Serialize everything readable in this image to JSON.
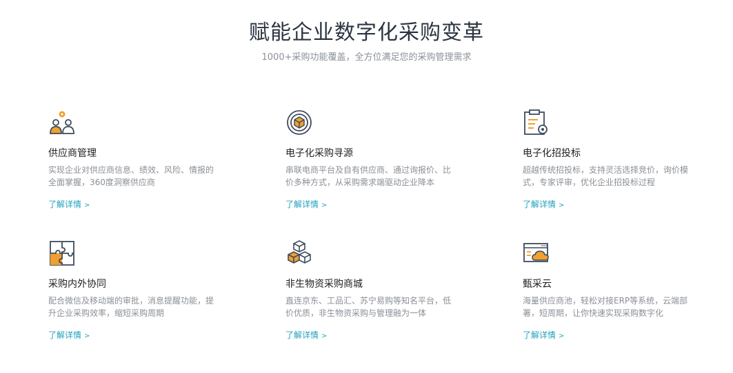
{
  "header": {
    "title": "赋能企业数字化采购变革",
    "subtitle": "1000+采购功能覆盖，全方位满足您的采购管理需求"
  },
  "cards": [
    {
      "icon": "supplier-management-icon",
      "title": "供应商管理",
      "description": "实现企业对供应商信息、绩效、风险、情报的全面掌握，360度洞察供应商",
      "link": "了解详情",
      "link_arrow": ">"
    },
    {
      "icon": "e-sourcing-icon",
      "title": "电子化采购寻源",
      "description": "串联电商平台及自有供应商、通过询报价、比价多种方式，从采购需求端驱动企业降本",
      "link": "了解详情",
      "link_arrow": ">"
    },
    {
      "icon": "e-bidding-icon",
      "title": "电子化招投标",
      "description": "超越传统招投标，支持灵活选择竞价，询价模式，专家评审，优化企业招投标过程",
      "link": "了解详情",
      "link_arrow": ">"
    },
    {
      "icon": "puzzle-collaboration-icon",
      "title": "采购内外协同",
      "description": "配合微信及移动端的审批，消息提醒功能，提升企业采购效率，缩短采购周期",
      "link": "了解详情",
      "link_arrow": ">"
    },
    {
      "icon": "cubes-mall-icon",
      "title": "非生物资采购商城",
      "description": "直连京东、工品汇、苏宁易购等知名平台，低价优质，非生物资采购与管理融为一体",
      "link": "了解详情",
      "link_arrow": ">"
    },
    {
      "icon": "cloud-icon",
      "title": "甄采云",
      "description": "海量供应商池，轻松对接ERP等系统，云端部署，短周期，让你快速实现采购数字化",
      "link": "了解详情",
      "link_arrow": ">"
    }
  ],
  "colors": {
    "accent": "#1fa2bc",
    "icon_stroke": "#3d4a5c",
    "icon_orange": "#f0a030"
  }
}
